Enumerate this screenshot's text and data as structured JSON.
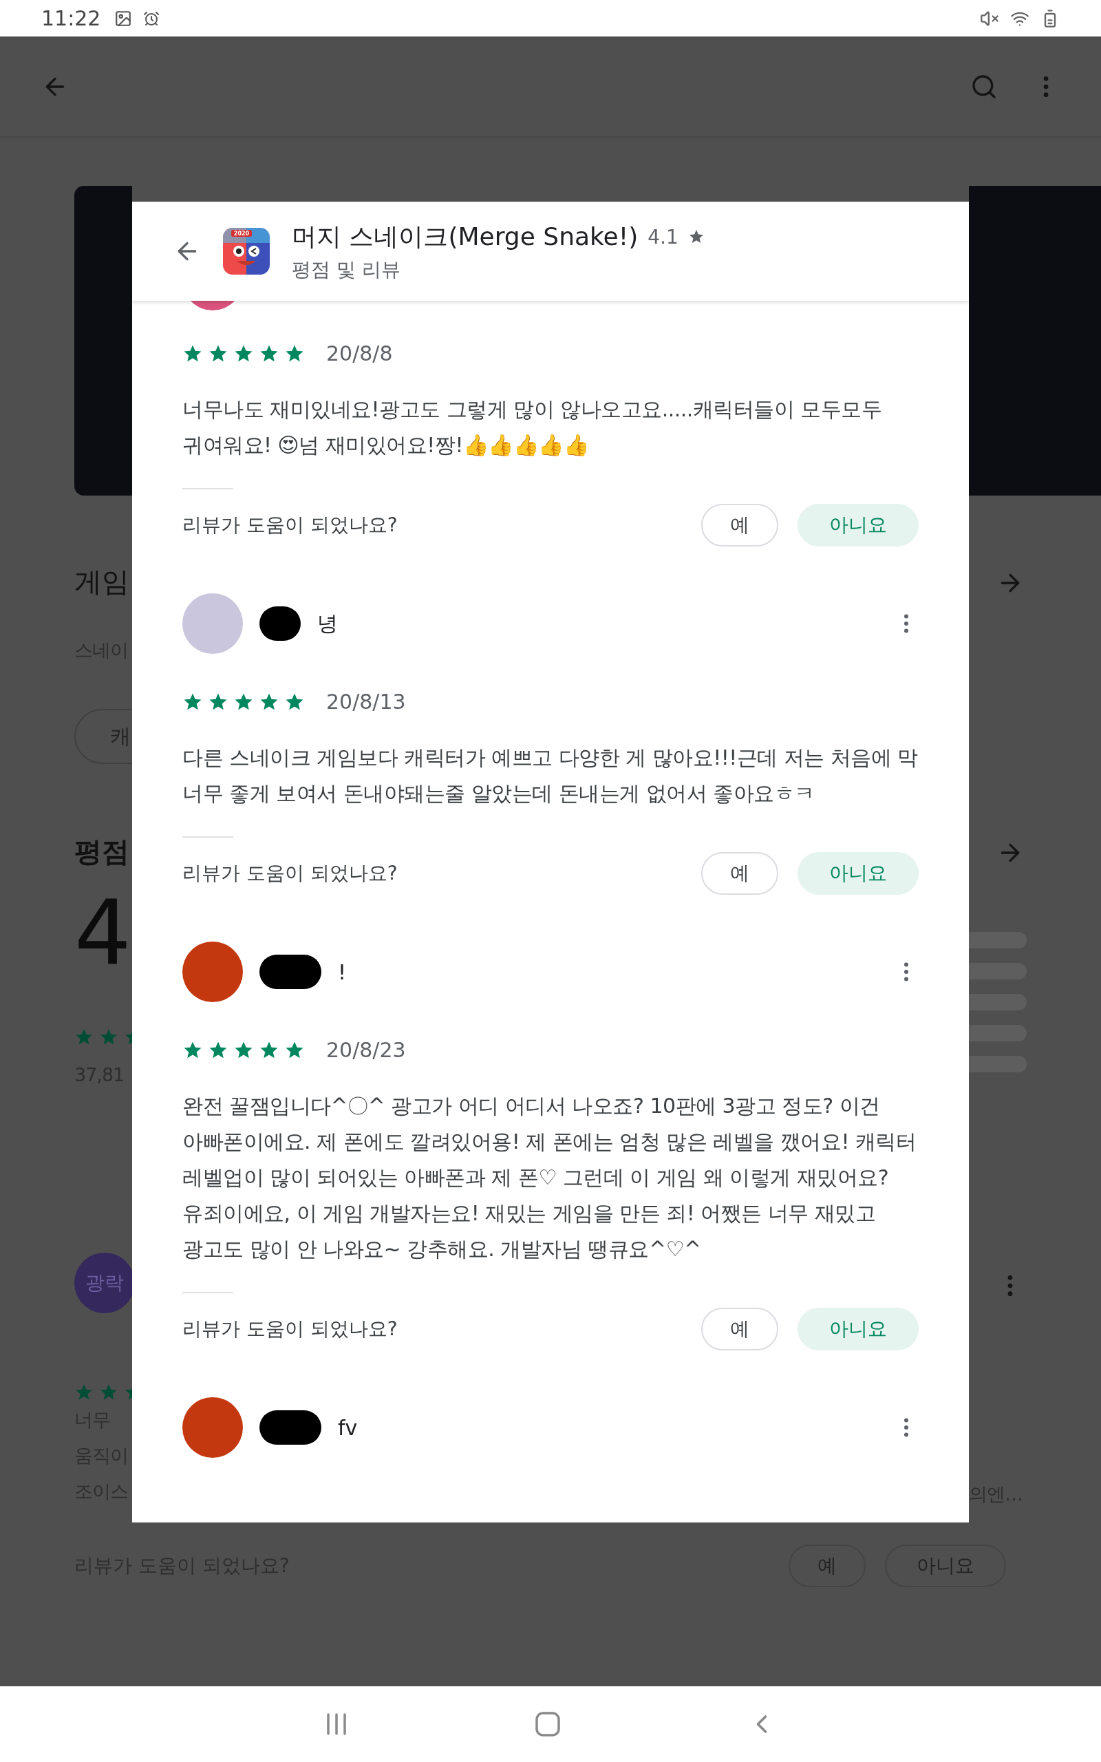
{
  "status_bar": {
    "time": "11:22"
  },
  "background_page": {
    "left": {
      "section_title": "게임",
      "section_text": "스네이",
      "chip": "캐",
      "rating_title": "평점",
      "rating_value": "4",
      "rating_count": "37,81",
      "review_avatar_text": "광락",
      "review_lines": [
        "너무",
        "움직이",
        "조이스"
      ]
    },
    "right": {
      "review_text_end": "의엔…"
    },
    "helpful": {
      "question": "리뷰가 도움이 되었나요?",
      "buttons": [
        {
          "label": "예",
          "kind": "outlined"
        },
        {
          "label": "아니요",
          "kind": "outlined"
        }
      ]
    }
  },
  "dialog": {
    "app_title": "머지 스네이크(Merge Snake!)",
    "app_rating": "4.1",
    "icon_badge": "2020",
    "subtitle": "평점 및 리뷰",
    "reviews": [
      {
        "avatar": {
          "color": "#d9537e"
        },
        "stars": 5,
        "date": "20/8/8",
        "text": "너무나도 재미있네요!광고도 그렇게 많이 않나오고요.....캐릭터들이 모두모두 귀여워요! 😍넘 재미있어요!짱!👍👍👍👍👍",
        "helpful": {
          "question": "리뷰가 도움이 되었나요?",
          "buttons": [
            {
              "label": "예",
              "kind": "outlined"
            },
            {
              "label": "아니요",
              "kind": "tonal"
            }
          ]
        }
      },
      {
        "avatar": {
          "color": "#c9c6de"
        },
        "name": "녕",
        "stars": 5,
        "date": "20/8/13",
        "text": "다른 스네이크 게임보다 캐릭터가 예쁘고 다양한 게 많아요!!!근데 저는 처음에 막 너무 좋게 보여서 돈내야돼는줄 알았는데 돈내는게 없어서 좋아요ㅎㅋ",
        "helpful": {
          "question": "리뷰가 도움이 되었나요?",
          "buttons": [
            {
              "label": "예",
              "kind": "outlined"
            },
            {
              "label": "아니요",
              "kind": "tonal"
            }
          ]
        }
      },
      {
        "avatar": {
          "color": "#c4380f"
        },
        "name": "!",
        "stars": 5,
        "date": "20/8/23",
        "text": "완전 꿀잼입니다^〇^ 광고가 어디 어디서 나오죠? 10판에 3광고 정도? 이건 아빠폰이에요. 제 폰에도 깔려있어용! 제 폰에는 엄청 많은 레벨을 깼어요! 캐릭터 레벨업이 많이 되어있는 아빠폰과 제 폰♡ 그런데 이 게임 왜 이렇게 재밌어요? 유죄이에요, 이 게임 개발자는요! 재밌는 게임을 만든 죄! 어쨌든 너무 재밌고 광고도 많이 안 나와요~ 강추해요. 개발자님 땡큐요^♡^",
        "helpful": {
          "question": "리뷰가 도움이 되었나요?",
          "buttons": [
            {
              "label": "예",
              "kind": "outlined"
            },
            {
              "label": "아니요",
              "kind": "tonal"
            }
          ]
        }
      },
      {
        "avatar": {
          "color": "#c4380f"
        },
        "name": "fv"
      }
    ]
  }
}
